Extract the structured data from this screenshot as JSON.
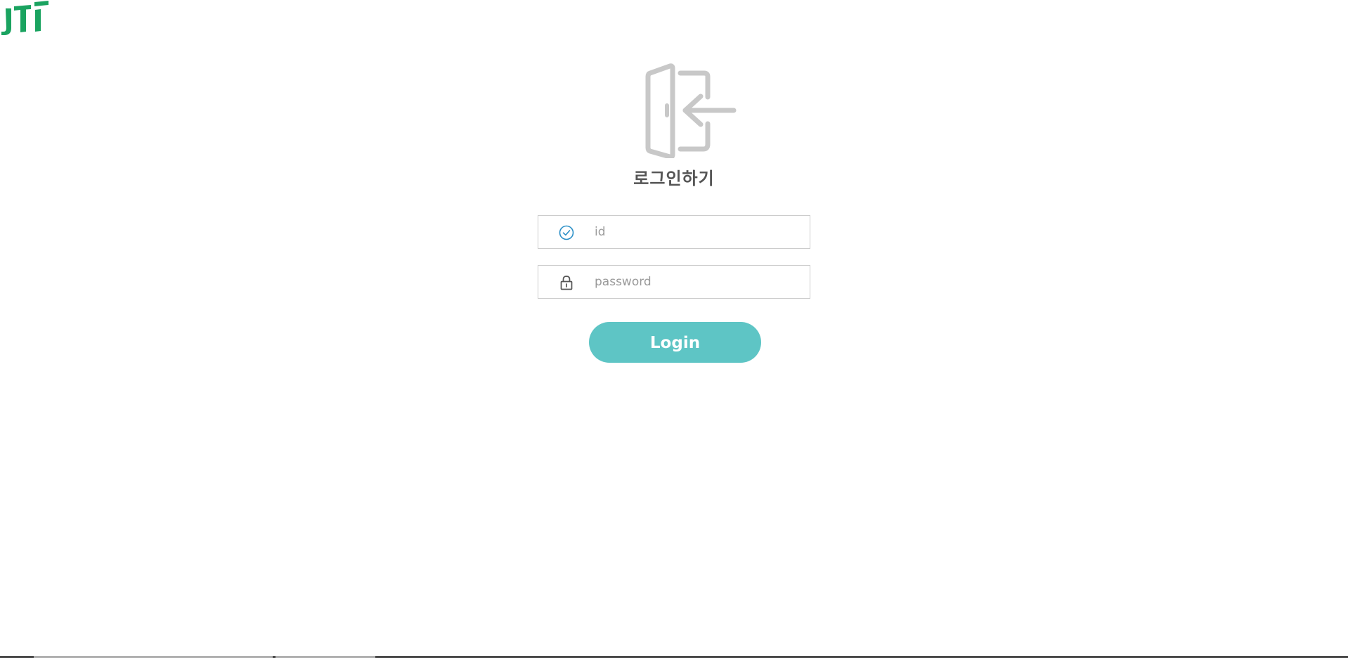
{
  "brand": {
    "logo_text": "JTI",
    "logo_color": "#1aa360"
  },
  "login": {
    "door_icon": "login-door-icon",
    "title": "로그인하기",
    "id_field": {
      "icon": "check-circle-icon",
      "icon_color": "#2a8fc7",
      "placeholder": "id",
      "value": ""
    },
    "password_field": {
      "icon": "lock-icon",
      "icon_color": "#555555",
      "placeholder": "password",
      "value": ""
    },
    "button_label": "Login",
    "button_color": "#5ec5c5"
  }
}
